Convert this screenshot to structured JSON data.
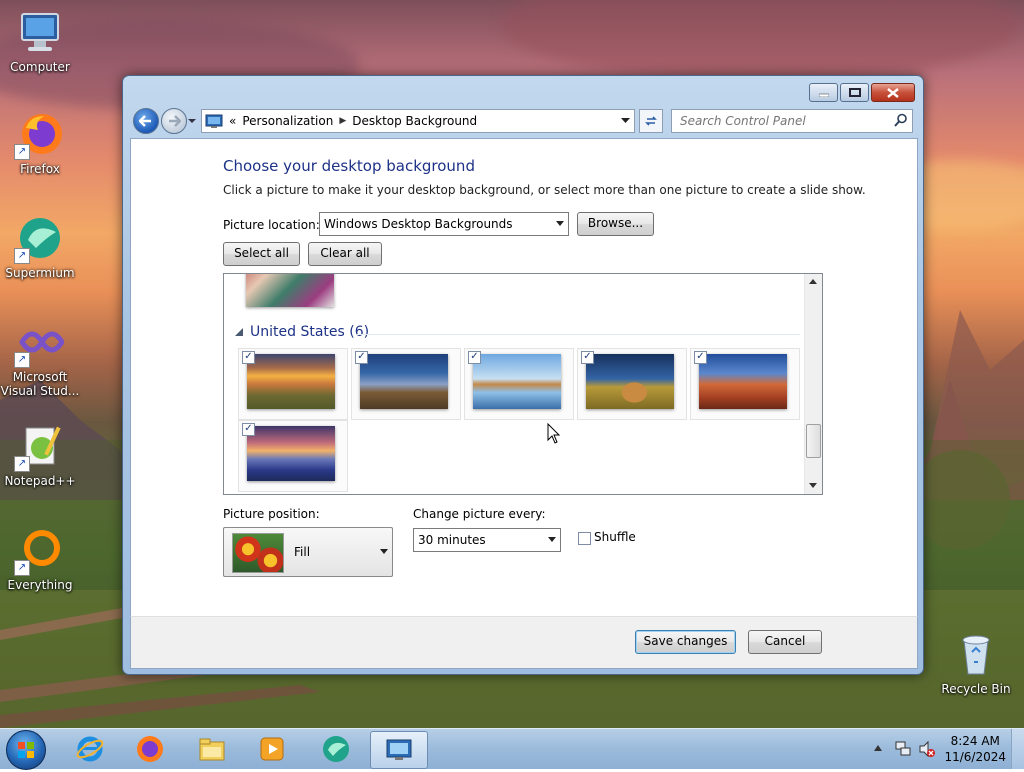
{
  "desktop": {
    "icons": [
      {
        "label": "Computer",
        "icon": "computer-icon"
      },
      {
        "label": "Firefox",
        "icon": "firefox-icon"
      },
      {
        "label": "Supermium",
        "icon": "supermium-icon"
      },
      {
        "label": "Microsoft Visual Stud...",
        "icon": "visual-studio-icon"
      },
      {
        "label": "Notepad++",
        "icon": "notepadpp-icon"
      },
      {
        "label": "Everything",
        "icon": "everything-icon"
      },
      {
        "label": "Recycle Bin",
        "icon": "recycle-bin-icon"
      }
    ]
  },
  "window": {
    "breadcrumb": [
      "Personalization",
      "Desktop Background"
    ],
    "breadcrumb_prefix": "«",
    "search_placeholder": "Search Control Panel",
    "title": "Choose your desktop background",
    "description": "Click a picture to make it your desktop background, or select more than one picture to create a slide show.",
    "picture_location_label": "Picture location:",
    "picture_location_value": "Windows Desktop Backgrounds",
    "browse_label": "Browse...",
    "select_all_label": "Select all",
    "clear_all_label": "Clear all",
    "group_label": "United States (6)",
    "pictures": [
      {
        "name": "sunset-prairie",
        "checked": true
      },
      {
        "name": "lighthouse",
        "checked": true
      },
      {
        "name": "rock-arch-lake",
        "checked": true
      },
      {
        "name": "hay-bale",
        "checked": true
      },
      {
        "name": "delicate-arch",
        "checked": true
      },
      {
        "name": "lupine-lake",
        "checked": true
      }
    ],
    "picture_position_label": "Picture position:",
    "picture_position_value": "Fill",
    "change_every_label": "Change picture every:",
    "change_every_value": "30 minutes",
    "shuffle_label": "Shuffle",
    "shuffle_checked": false,
    "save_label": "Save changes",
    "cancel_label": "Cancel"
  },
  "taskbar": {
    "apps": [
      "internet-explorer-icon",
      "firefox-icon",
      "file-explorer-icon",
      "media-player-icon",
      "supermium-icon",
      "control-panel-icon"
    ],
    "time": "8:24 AM",
    "date": "11/6/2024"
  }
}
